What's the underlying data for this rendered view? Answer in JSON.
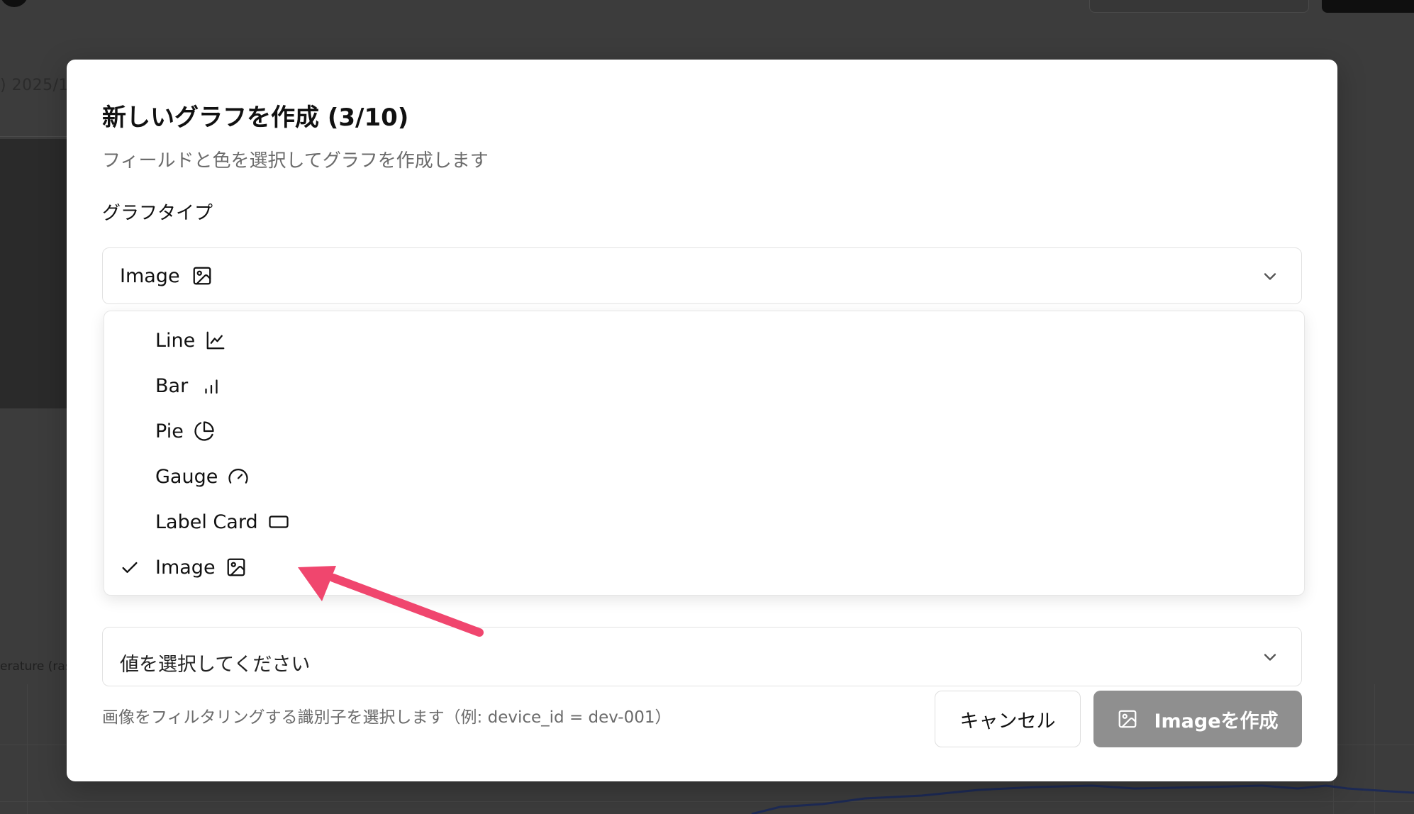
{
  "background": {
    "date_fragment": ") 2025/1",
    "chart_label_fragment": "erature (ras"
  },
  "modal": {
    "title": "新しいグラフを作成 (3/10)",
    "description": "フィールドと色を選択してグラフを作成します",
    "graph_type_label": "グラフタイプ",
    "graph_type_selected": "Image",
    "value_select_text": "値を選択してください",
    "hint": "画像をフィルタリングする識別子を選択します（例: device_id = dev-001）",
    "cancel_label": "キャンセル",
    "create_label": "Imageを作成"
  },
  "dropdown": {
    "options": [
      {
        "label": "Line",
        "icon": "line-chart-icon",
        "selected": false
      },
      {
        "label": "Bar",
        "icon": "bar-chart-icon",
        "selected": false
      },
      {
        "label": "Pie",
        "icon": "pie-chart-icon",
        "selected": false
      },
      {
        "label": "Gauge",
        "icon": "gauge-icon",
        "selected": false
      },
      {
        "label": "Label Card",
        "icon": "card-icon",
        "selected": false
      },
      {
        "label": "Image",
        "icon": "image-icon",
        "selected": true
      }
    ]
  },
  "colors": {
    "create_button_bg": "#8f8f8f",
    "annotation_arrow": "#f0466e"
  }
}
